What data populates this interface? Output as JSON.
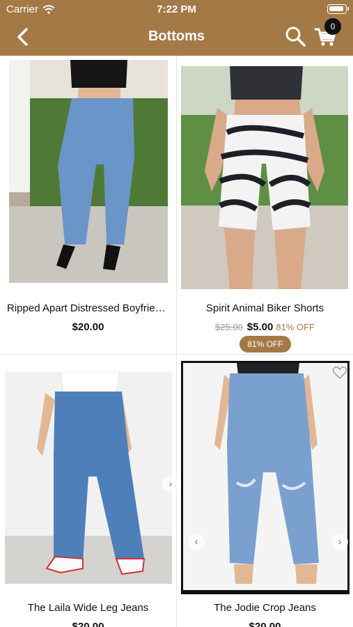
{
  "colors": {
    "brand": "#a37a45"
  },
  "status_bar": {
    "carrier": "Carrier",
    "time": "7:22 PM"
  },
  "header": {
    "title": "Bottoms",
    "cart_count": "0",
    "icons": [
      "back-chevron-icon",
      "search-icon",
      "cart-icon"
    ]
  },
  "products": [
    {
      "name": "Ripped Apart Distressed Boyfrien…",
      "price": "$20.00"
    },
    {
      "name": "Spirit Animal Biker Shorts",
      "original_price": "$25.00",
      "price": "$5.00",
      "discount_text": "81% OFF",
      "discount_badge": "81% OFF"
    },
    {
      "name": "The Laila Wide Leg Jeans",
      "price": "$20.00"
    },
    {
      "name": "The Jodie Crop Jeans",
      "price": "$20.00"
    }
  ]
}
